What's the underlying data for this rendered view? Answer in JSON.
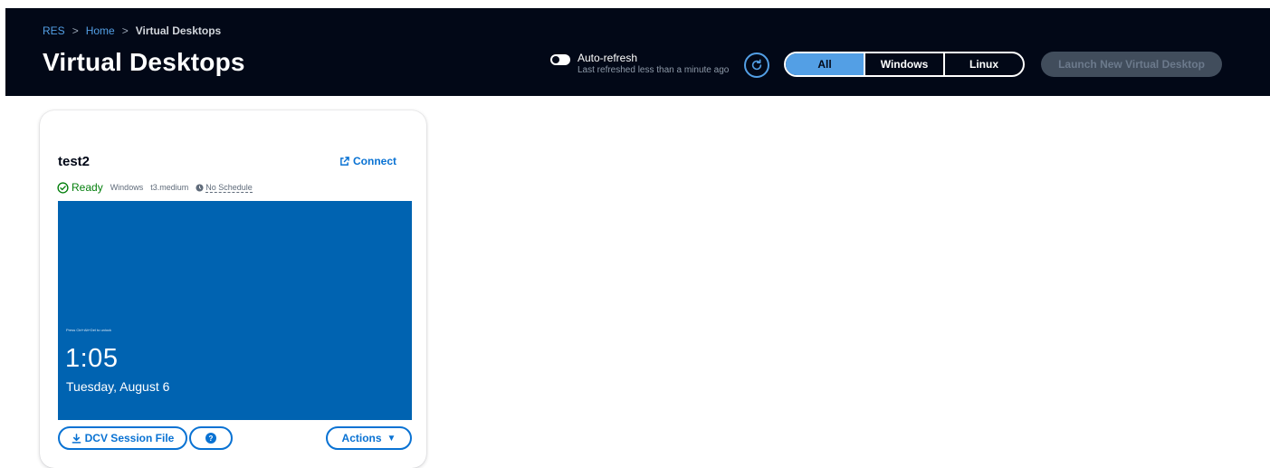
{
  "breadcrumb": {
    "root": "RES",
    "home": "Home",
    "current": "Virtual Desktops",
    "separator": ">"
  },
  "header": {
    "title": "Virtual Desktops",
    "auto_refresh_label": "Auto-refresh",
    "auto_refresh_status": "Last refreshed less than a minute ago",
    "auto_refresh_enabled": false,
    "filters": [
      {
        "label": "All",
        "active": true
      },
      {
        "label": "Windows",
        "active": false
      },
      {
        "label": "Linux",
        "active": false
      }
    ],
    "launch_button": "Launch New Virtual Desktop",
    "launch_disabled": true
  },
  "desktop_card": {
    "name": "test2",
    "connect_label": "Connect",
    "status": "Ready",
    "os": "Windows",
    "instance_type": "t3.medium",
    "schedule": "No Schedule",
    "preview": {
      "hint": "Press Ctrl+Alt+Del to unlock",
      "time": "1:05",
      "date": "Tuesday, August 6"
    },
    "dcv_button": "DCV Session File",
    "help_button": "?",
    "actions_button": "Actions"
  },
  "colors": {
    "header_bg": "#020817",
    "accent_blue": "#539fe5",
    "link_blue": "#0972d3",
    "ready_green": "#037f0c",
    "preview_bg": "#0063b1"
  }
}
